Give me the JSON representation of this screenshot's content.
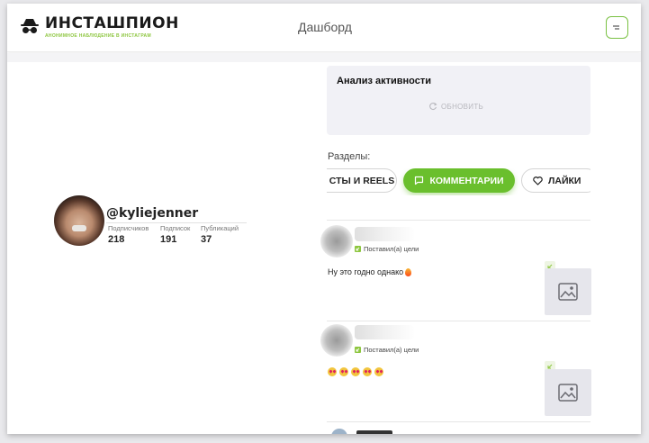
{
  "header": {
    "logo_title": "ИНСТАШПИОН",
    "logo_subtitle": "анонимное наблюдение в инстаграм",
    "page_title": "Дашборд",
    "menu_icon": "menu-icon"
  },
  "profile": {
    "username": "@kyliejenner",
    "stats": [
      {
        "label": "Подписчиков",
        "value": "218"
      },
      {
        "label": "Подписок",
        "value": "191"
      },
      {
        "label": "Публикаций",
        "value": "37"
      }
    ]
  },
  "activity": {
    "title": "Анализ активности",
    "refresh_label": "ОБНОВИТЬ"
  },
  "sections": {
    "label": "Разделы:",
    "tabs": [
      {
        "label": "СТЫ И REELS",
        "icon": "grid-icon",
        "active": false
      },
      {
        "label": "КОММЕНТАРИИ",
        "icon": "comment-icon",
        "active": true
      },
      {
        "label": "ЛАЙКИ",
        "icon": "heart-icon",
        "active": false
      }
    ]
  },
  "comments": [
    {
      "status": "Поставил(а) цели",
      "text": "Ну это годно однако"
    },
    {
      "status": "Поставил(а) цели",
      "text": ""
    }
  ],
  "colors": {
    "accent": "#6abf2d",
    "brand_green": "#8dc63f"
  }
}
